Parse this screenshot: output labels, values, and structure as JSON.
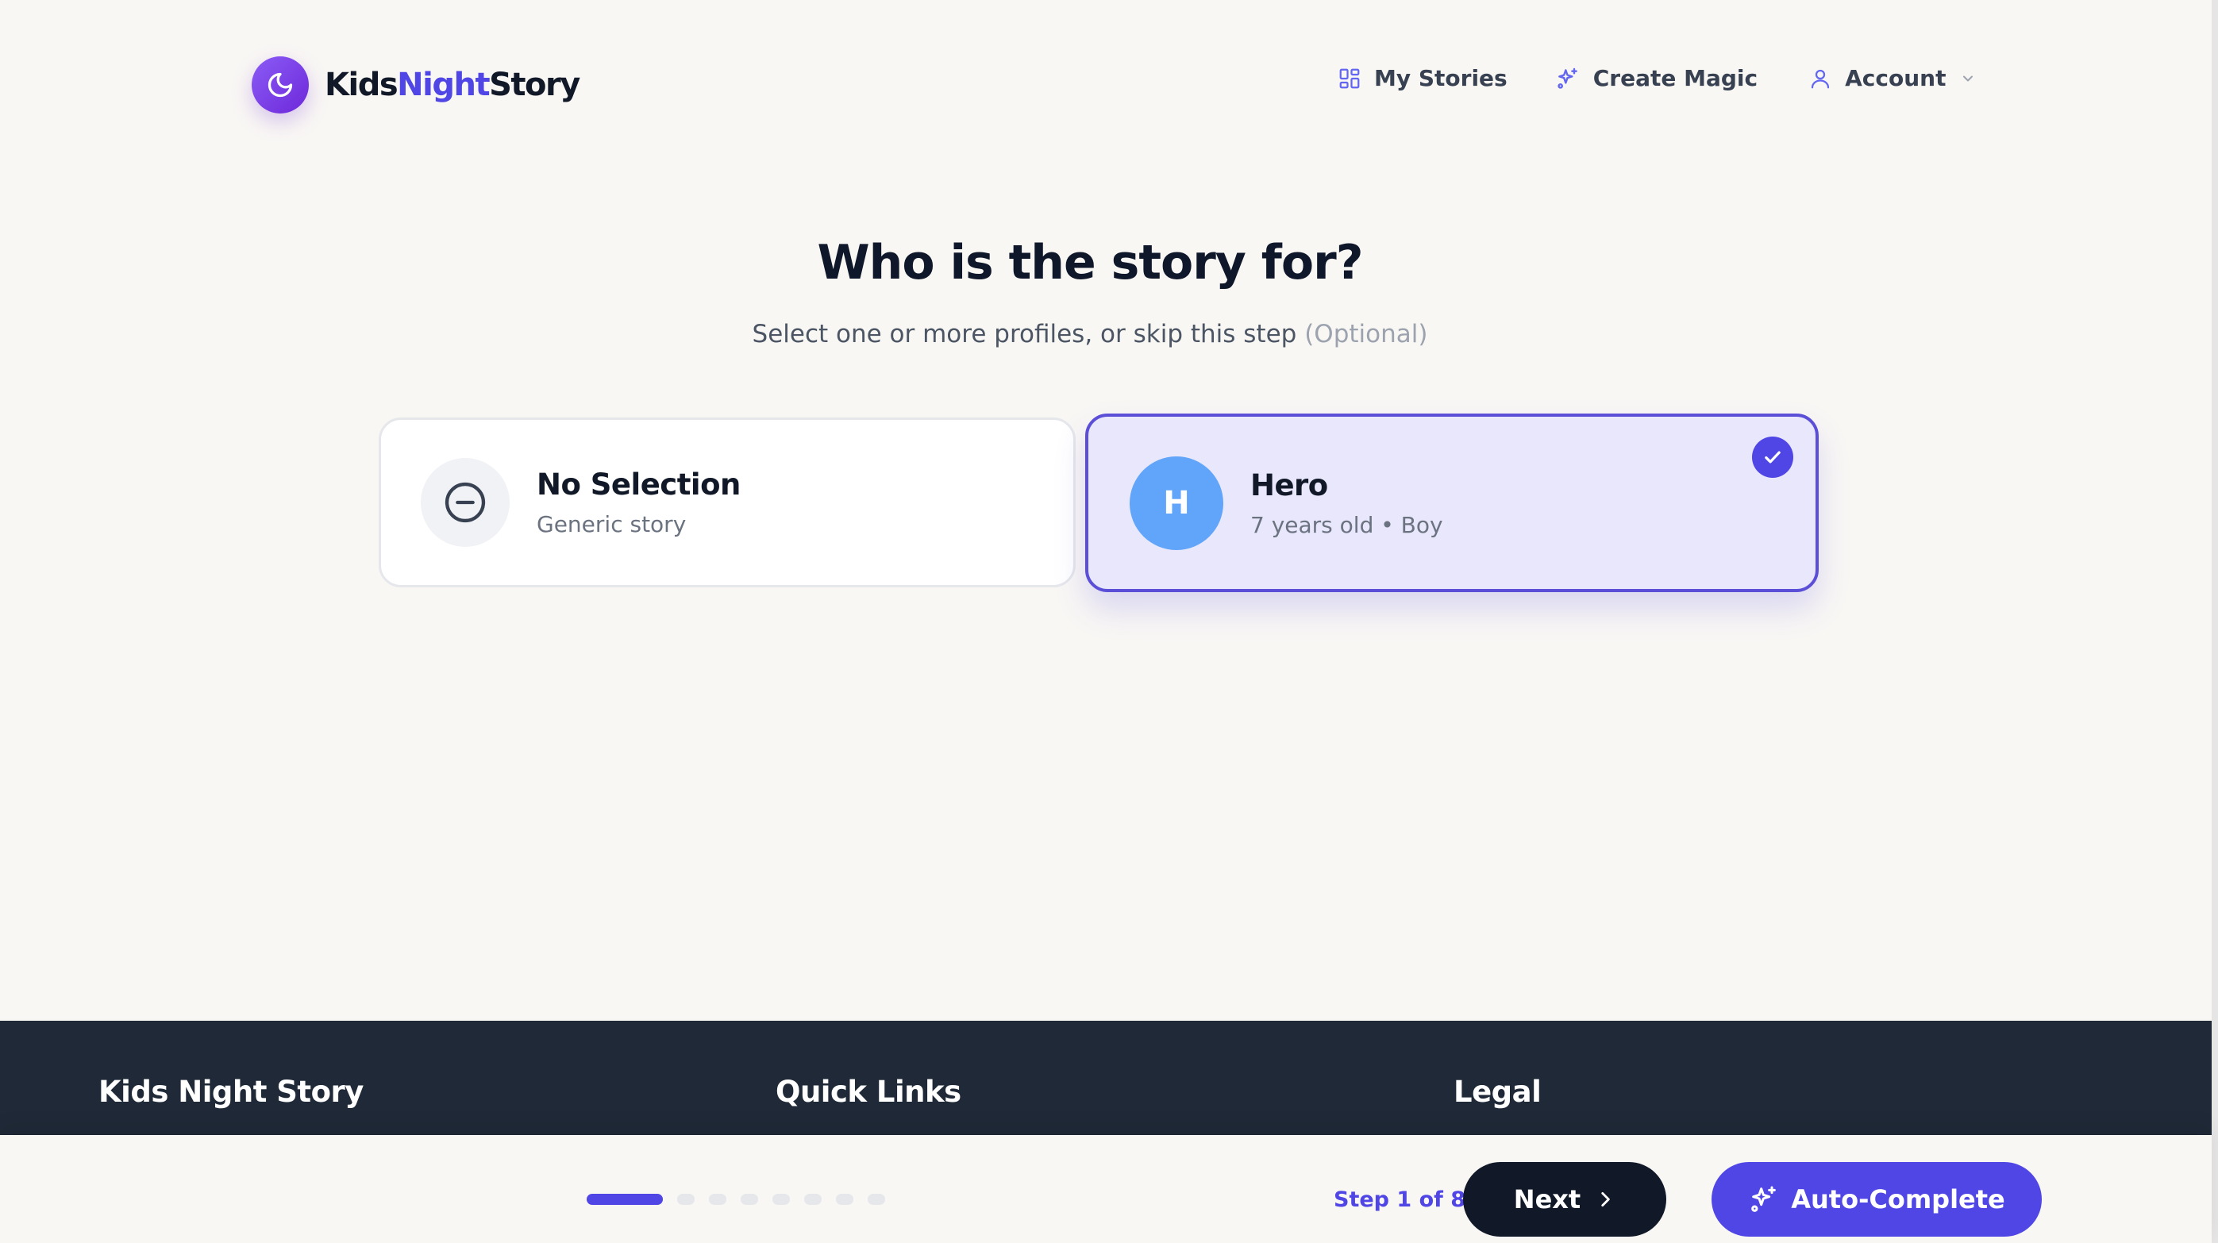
{
  "brand": {
    "part1": "Kids",
    "part2": "Night",
    "part3": "Story",
    "accent_color": "#4f46e5",
    "icon": "moon-icon"
  },
  "nav": {
    "my_stories": "My Stories",
    "create_magic": "Create Magic",
    "account": "Account"
  },
  "page": {
    "title": "Who is the story for?",
    "subtitle": "Select one or more profiles, or skip this step",
    "optional": "(Optional)"
  },
  "profiles": [
    {
      "name": "No Selection",
      "description": "Generic story",
      "icon": "minus-circle-icon",
      "selected": false
    },
    {
      "name": "Hero",
      "initial": "H",
      "description": "7 years old • Boy",
      "avatar_color": "#60a5fa",
      "selected": true
    }
  ],
  "footer": {
    "col1": "Kids Night Story",
    "col2": "Quick Links",
    "col3": "Legal"
  },
  "wizard": {
    "current_step": 1,
    "total_steps": 8,
    "step_label": "Step 1 of 8",
    "next_label": "Next",
    "auto_label": "Auto-Complete"
  }
}
